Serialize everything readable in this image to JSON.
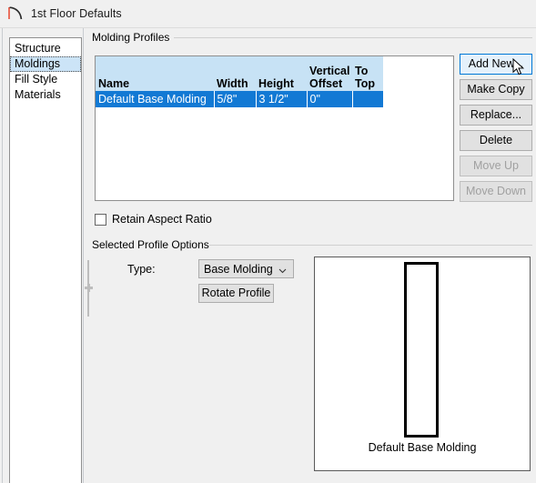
{
  "window": {
    "title": "1st Floor Defaults",
    "icon": "arc-wall-icon"
  },
  "sidebar": {
    "items": [
      {
        "label": "Structure",
        "selected": false
      },
      {
        "label": "Moldings",
        "selected": true
      },
      {
        "label": "Fill Style",
        "selected": false
      },
      {
        "label": "Materials",
        "selected": false
      }
    ]
  },
  "molding_profiles": {
    "group_label": "Molding Profiles",
    "columns": [
      "Name",
      "Width",
      "Height",
      "Vertical Offset",
      "To Top"
    ],
    "columns_split": [
      {
        "line1": "",
        "line2": "Name"
      },
      {
        "line1": "",
        "line2": "Width"
      },
      {
        "line1": "",
        "line2": "Height"
      },
      {
        "line1": "Vertical",
        "line2": "Offset"
      },
      {
        "line1": "To",
        "line2": "Top"
      }
    ],
    "rows": [
      {
        "name": "Default Base Molding",
        "width": "5/8\"",
        "height": "3 1/2\"",
        "vertical_offset": "0\"",
        "to_top": "",
        "selected": true
      }
    ],
    "buttons": [
      {
        "label": "Add New...",
        "state": "hovered"
      },
      {
        "label": "Make Copy",
        "state": "normal"
      },
      {
        "label": "Replace...",
        "state": "normal"
      },
      {
        "label": "Delete",
        "state": "normal"
      },
      {
        "label": "Move Up",
        "state": "disabled"
      },
      {
        "label": "Move Down",
        "state": "disabled"
      }
    ],
    "retain_aspect_ratio": {
      "label": "Retain Aspect Ratio",
      "checked": false
    }
  },
  "selected_profile_options": {
    "group_label": "Selected Profile Options",
    "type_label": "Type:",
    "type_value": "Base Molding",
    "rotate_button": "Rotate Profile",
    "preview_caption": "Default Base Molding"
  },
  "colors": {
    "selection_row": "#1279d4",
    "header_background": "#c7e2f5",
    "sidebar_selection": "#cce4f7",
    "hover_border": "#0078d7",
    "dialog_background": "#f0f0f0",
    "icon_accent": "#e8503a"
  }
}
